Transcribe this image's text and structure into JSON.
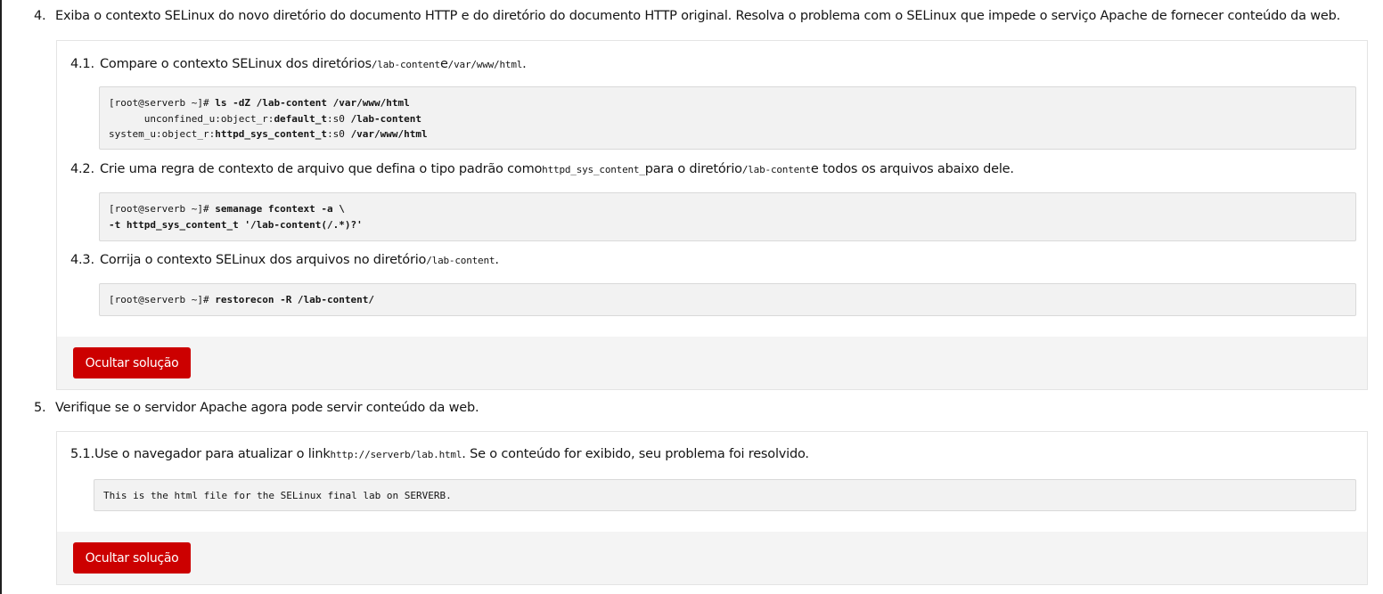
{
  "step4": {
    "num": "4.",
    "text": "Exiba o contexto SELinux do novo diretório do documento HTTP e do diretório do documento HTTP original. Resolva o problema com o SELinux que impede o serviço Apache de fornecer conteúdo da web.",
    "sub1": {
      "num": "4.1.",
      "text_a": "Compare o contexto SELinux dos diretórios ",
      "code_a": "/lab-content",
      "text_b": " e ",
      "code_b": "/var/www/html",
      "text_c": ".",
      "prompt": "[root@serverb ~]# ",
      "command": "ls -dZ /lab-content /var/www/html",
      "out1_a": "      unconfined_u:object_r:",
      "out1_b": "default_t",
      "out1_c": ":s0 ",
      "out1_d": "/lab-content",
      "out2_a": "system_u:object_r:",
      "out2_b": "httpd_sys_content_t",
      "out2_c": ":s0 ",
      "out2_d": "/var/www/html"
    },
    "sub2": {
      "num": "4.2.",
      "text_a": "Crie uma regra de contexto de arquivo que defina o tipo padrão como ",
      "code_a": "httpd_sys_content_",
      "text_b": " para o diretório ",
      "code_b": "/lab-content",
      "text_c": " e todos os arquivos abaixo dele.",
      "prompt": "[root@serverb ~]# ",
      "command_line1": "semanage fcontext -a \\",
      "command_line2": "-t httpd_sys_content_t '/lab-content(/.*)?'"
    },
    "sub3": {
      "num": "4.3.",
      "text_a": "Corrija o contexto SELinux dos arquivos no diretório ",
      "code_a": "/lab-content",
      "text_b": ".",
      "prompt": "[root@serverb ~]# ",
      "command": "restorecon -R /lab-content/"
    },
    "button": "Ocultar solução"
  },
  "step5": {
    "num": "5.",
    "text": "Verifique se o servidor Apache agora pode servir conteúdo da web.",
    "sub1": {
      "num": "5.1.",
      "text_a": "Use o navegador para atualizar o link ",
      "code_a": "http://serverb/lab.html",
      "text_b": ". Se o conteúdo for exibido, seu problema foi resolvido.",
      "output": "This is the html file for the SELinux final lab on SERVERB."
    },
    "button": "Ocultar solução"
  }
}
